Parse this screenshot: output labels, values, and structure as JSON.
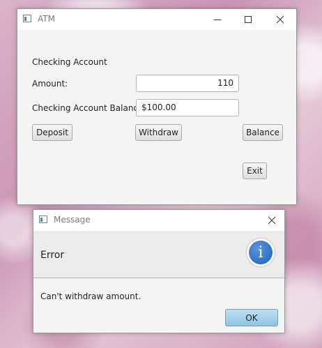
{
  "atm_window": {
    "title": "ATM",
    "account_heading": "Checking Account",
    "amount_label": "Amount:",
    "amount_value": "110",
    "balance_label": "Checking Account Balance:",
    "balance_value": "$100.00",
    "deposit_label": "Deposit",
    "withdraw_label": "Withdraw",
    "balance_button_label": "Balance",
    "exit_label": "Exit"
  },
  "message_dialog": {
    "title": "Message",
    "header": "Error",
    "info_glyph": "i",
    "message": "Can't withdraw amount.",
    "ok_label": "OK"
  },
  "icons": [
    "app-icon",
    "minimize-icon",
    "maximize-icon",
    "close-icon",
    "info-icon"
  ],
  "colors": {
    "info_circle": "#2f6fc4",
    "ok_button": "#9fcfeb"
  }
}
